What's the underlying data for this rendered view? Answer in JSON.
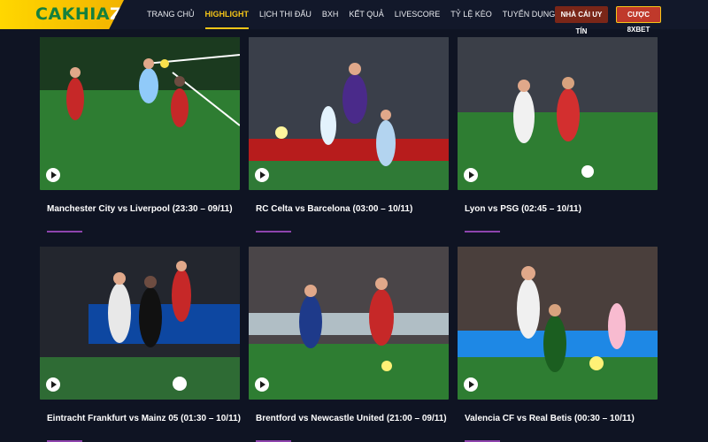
{
  "brand": {
    "logo_main": "CAKHIA",
    "logo_z": "Z"
  },
  "nav": [
    {
      "label": "TRANG CHỦ"
    },
    {
      "label": "HIGHLIGHT",
      "active": true
    },
    {
      "label": "LỊCH THI ĐẤU"
    },
    {
      "label": "BXH"
    },
    {
      "label": "KẾT QUẢ"
    },
    {
      "label": "LIVESCORE"
    },
    {
      "label": "TỶ LỆ KÈO"
    },
    {
      "label": "TUYỂN DỤNG"
    }
  ],
  "buttons": {
    "trusted": "NHÀ CÁI UY TÍN",
    "bet": "CƯỢC 8XBET"
  },
  "videos": [
    {
      "title": "Manchester City vs Liverpool (23:30 – 09/11)"
    },
    {
      "title": "RC Celta vs Barcelona (03:00 – 10/11)"
    },
    {
      "title": "Lyon vs PSG (02:45 – 10/11)"
    },
    {
      "title": "Eintracht Frankfurt vs Mainz 05 (01:30 – 10/11)"
    },
    {
      "title": "Brentford vs Newcastle United (21:00 – 09/11)"
    },
    {
      "title": "Valencia CF vs Real Betis (00:30 – 10/11)"
    }
  ],
  "colors": {
    "accent": "#f5c518",
    "underline": "#8e44ad",
    "background": "#0f1423"
  },
  "icons": {
    "play": "play-icon"
  }
}
